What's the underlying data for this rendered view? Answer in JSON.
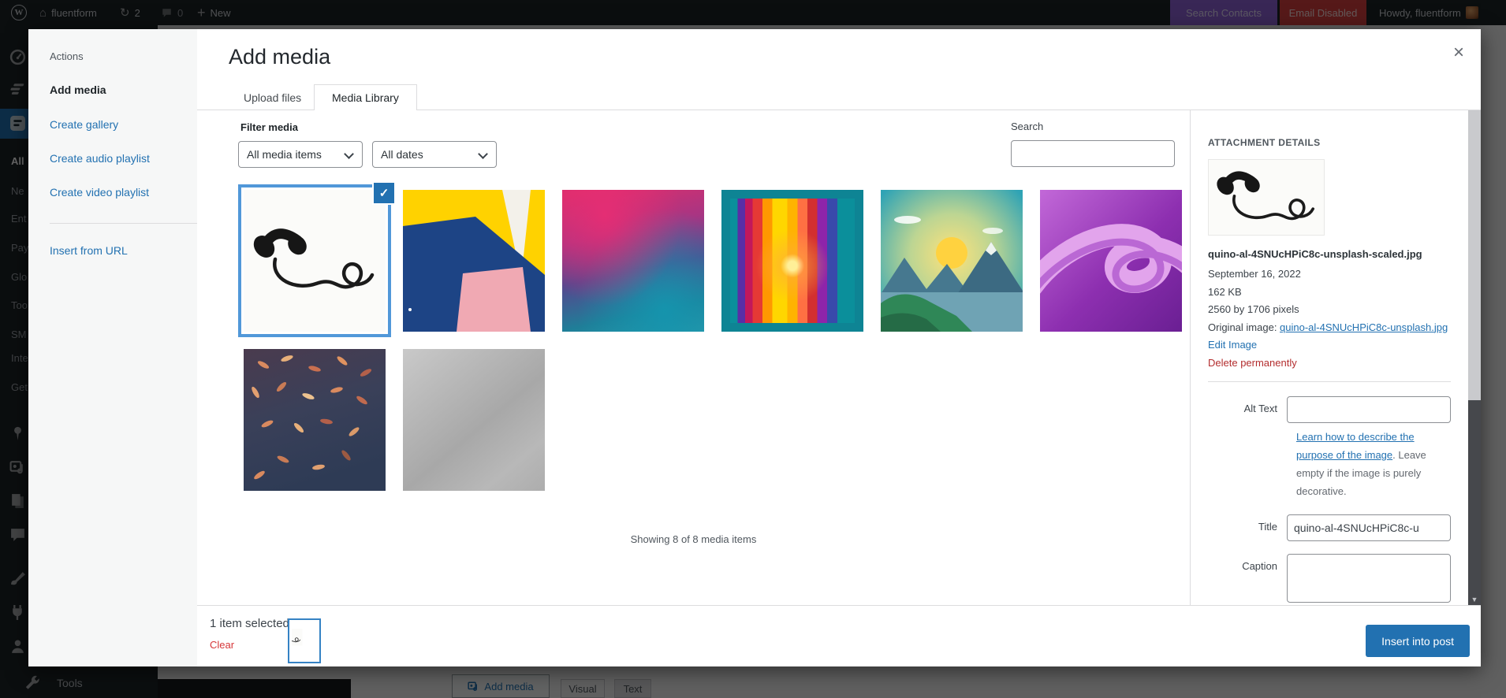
{
  "admin_bar": {
    "site_name": "fluentform",
    "updates_count": "2",
    "comments_count": "0",
    "new_label": "New",
    "search_contacts": "Search Contacts",
    "email_disabled": "Email Disabled",
    "howdy": "Howdy, fluentform"
  },
  "admin_menu": {
    "submenu_items": [
      "All",
      "Ne",
      "Ent",
      "Pay",
      "Glo",
      "Too",
      "SM",
      "Inte",
      "Get"
    ],
    "tools_label": "Tools"
  },
  "editor_behind": {
    "add_media_button": "Add media",
    "visual_tab": "Visual",
    "text_tab": "Text"
  },
  "modal": {
    "title": "Add media",
    "menu": {
      "heading": "Actions",
      "add_media": "Add media",
      "create_gallery": "Create gallery",
      "create_audio": "Create audio playlist",
      "create_video": "Create video playlist",
      "insert_url": "Insert from URL"
    },
    "tabs": {
      "upload": "Upload files",
      "library": "Media Library"
    },
    "filter": {
      "label": "Filter media",
      "type_value": "All media items",
      "date_value": "All dates",
      "search_label": "Search",
      "search_value": ""
    },
    "grid": {
      "status": "Showing 8 of 8 media items"
    },
    "details": {
      "heading": "ATTACHMENT DETAILS",
      "filename": "quino-al-4SNUcHPiC8c-unsplash-scaled.jpg",
      "date": "September 16, 2022",
      "filesize": "162 KB",
      "dimensions": "2560 by 1706 pixels",
      "original_label": "Original image: ",
      "original_link": "quino-al-4SNUcHPiC8c-unsplash.jpg",
      "edit_image": "Edit Image",
      "delete": "Delete permanently",
      "alt_label": "Alt Text",
      "alt_value": "",
      "alt_help_link": "Learn how to describe the purpose of the image",
      "alt_help_rest": ". Leave empty if the image is purely decorative.",
      "title_label": "Title",
      "title_value": "quino-al-4SNUcHPiC8c-u",
      "caption_label": "Caption"
    },
    "toolbar": {
      "selected_text": "1 item selected",
      "clear": "Clear",
      "insert_button": "Insert into post"
    }
  },
  "icons": {
    "wp": "W",
    "home": "⌂",
    "refresh": "↻",
    "plus": "+",
    "close": "×",
    "check": "✓",
    "scroll_down": "▼"
  },
  "colors": {
    "accent_blue": "#2271b1",
    "selection_blue": "#5198d9",
    "danger_red": "#d63638",
    "delete_red": "#b32d2e",
    "admin_dark": "#1d2327",
    "sidebar_gray": "#f6f7f7",
    "search_contacts_purple": "#8f63d8",
    "email_disabled_red": "#d84040"
  }
}
